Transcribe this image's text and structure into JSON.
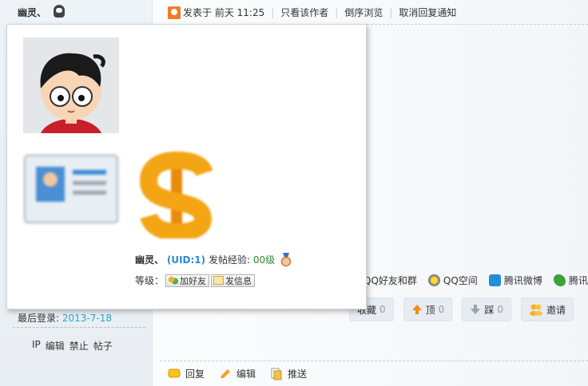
{
  "author": {
    "name": "幽灵、"
  },
  "post_header": {
    "posted": "发表于 前天 11:25",
    "only_author": "只看该作者",
    "reverse": "倒序浏览",
    "cancel_notify": "取消回复通知"
  },
  "popup": {
    "username": "幽灵、",
    "uid": "(UID:1)",
    "exp_label": "发帖经验:",
    "exp_value": "00级",
    "level_label": "等级：",
    "add_friend": "加好友",
    "send_msg": "发信息"
  },
  "share": {
    "qq_friends": "QQ好友和群",
    "qzone": "QQ空间",
    "tweibo": "腾讯微博",
    "tpengyou": "腾讯"
  },
  "actions": [
    {
      "label": "收藏",
      "count": "0"
    },
    {
      "label": "顶",
      "count": "0"
    },
    {
      "label": "踩",
      "count": "0"
    },
    {
      "label": "邀请"
    }
  ],
  "last_login": {
    "label": "最后登录:",
    "date": "2013-7-18"
  },
  "admin": {
    "ip": "IP",
    "edit": "编辑",
    "ban": "禁止",
    "posts": "帖子"
  },
  "bottom": {
    "reply": "回复",
    "edit": "编辑",
    "push": "推送"
  },
  "colors": {
    "accent": "#2a8bd6",
    "orange": "#f07d27",
    "green": "#2e8b2e"
  }
}
